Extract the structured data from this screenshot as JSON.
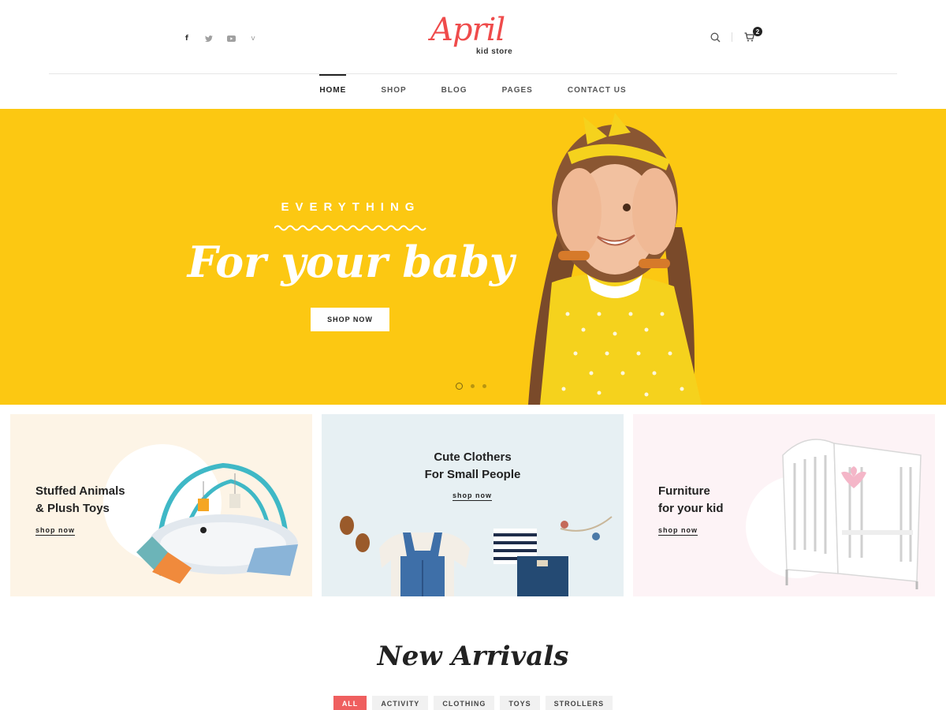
{
  "header": {
    "social": [
      {
        "icon": "facebook-icon",
        "glyph": "f"
      },
      {
        "icon": "twitter-icon",
        "glyph": "t"
      },
      {
        "icon": "youtube-icon",
        "glyph": "▶"
      },
      {
        "icon": "vimeo-icon",
        "glyph": "v"
      }
    ],
    "logo_script": "April",
    "logo_sub": "kid store",
    "cart_count": "2"
  },
  "nav": {
    "items": [
      {
        "label": "HOME"
      },
      {
        "label": "SHOP"
      },
      {
        "label": "BLOG"
      },
      {
        "label": "PAGES"
      },
      {
        "label": "CONTACT US"
      }
    ]
  },
  "hero": {
    "eyebrow": "EVERYTHING",
    "title": "For your baby",
    "button": "SHOP NOW",
    "slides": 3,
    "active_slide": 1
  },
  "categories": [
    {
      "line1": "Stuffed Animals",
      "line2": "& Plush Toys",
      "link": "shop now"
    },
    {
      "line1": "Cute Clothers",
      "line2": "For Small People",
      "link": "shop now"
    },
    {
      "line1": "Furniture",
      "line2": "for your kid",
      "link": "shop now"
    }
  ],
  "arrivals": {
    "title": "New Arrivals",
    "filters": [
      {
        "label": "ALL"
      },
      {
        "label": "ACTIVITY"
      },
      {
        "label": "CLOTHING"
      },
      {
        "label": "TOYS"
      },
      {
        "label": "STROLLERS"
      }
    ]
  },
  "colors": {
    "accent": "#ef4b4b",
    "hero_bg": "#fcc812",
    "filter_active": "#ef5f5f"
  }
}
